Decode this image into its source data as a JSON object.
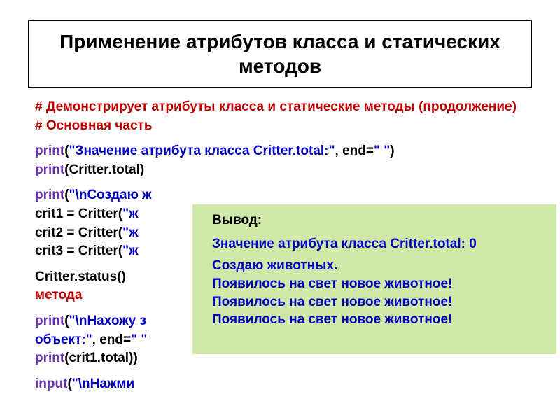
{
  "title": "Применение атрибутов класса и статических  методов",
  "code": {
    "comment1": "# Демонстрирует атрибуты класса и статические методы (продолжение)",
    "comment2": "# Основная часть",
    "c1": {
      "kw1": "print",
      "p1": "(",
      "s1": "\"Значение атрибута класса Critter.total:\"",
      "e1": ", end=",
      "s2": "\" \"",
      "p2": ")"
    },
    "c2": {
      "kw1": "print",
      "rest": "(Critter.total)"
    },
    "c3": {
      "kw1": "print",
      "p1": "(",
      "s1": "\"\\nСоздаю ж"
    },
    "c4a": {
      "pre": "crit1 = Critter(",
      "s": "\"ж"
    },
    "c4b": {
      "pre": "crit2 = Critter(",
      "s": "\"ж"
    },
    "c4c": {
      "pre": "crit3 = Critter(",
      "s": "\"ж"
    },
    "c5": "Critter.status()",
    "c5r": "метода",
    "c6": {
      "kw1": "print",
      "p1": "(",
      "s1": "\"\\nНахожу з"
    },
    "c7": {
      "s1": "объект:\"",
      "e1": ", end=",
      "s2": "\" \""
    },
    "c8": {
      "kw1": "print",
      "rest": "(crit1.total))"
    },
    "c9": {
      "kw1": "input",
      "p1": "(",
      "s1": "\"\\nНажми"
    }
  },
  "output": {
    "label": "Вывод:",
    "l1": "Значение атрибута класса Critter.total: 0",
    "l2": "Создаю животных.",
    "l3": "Появилось на свет новое животное!",
    "l4": "Появилось на свет новое животное!",
    "l5": "Появилось на свет новое животное!"
  }
}
